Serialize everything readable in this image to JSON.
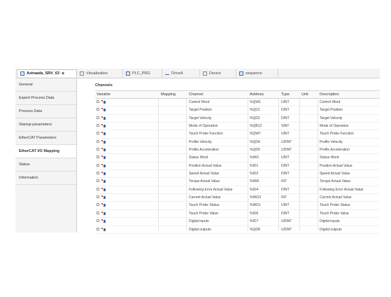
{
  "tabs": [
    {
      "label": "Astraada_SRV_63",
      "active": true,
      "icon": "device-icon",
      "close": "×"
    },
    {
      "label": "Visualization",
      "icon": "visualization-icon"
    },
    {
      "label": "PLC_PRG",
      "icon": "program-icon"
    },
    {
      "label": "DriveA",
      "icon": "trend-icon"
    },
    {
      "label": "Device",
      "icon": "device-icon"
    },
    {
      "label": "sequence",
      "icon": "sequence-icon"
    }
  ],
  "sidebar": {
    "items": [
      {
        "label": "General"
      },
      {
        "label": "Expert Process Data"
      },
      {
        "label": "Process Data"
      },
      {
        "label": "Startup parameters"
      },
      {
        "label": "EtherCAT Parameters"
      },
      {
        "label": "EtherCAT I/O Mapping",
        "active": true
      },
      {
        "label": "Status"
      },
      {
        "label": "Information"
      }
    ]
  },
  "main": {
    "section_title": "Channels",
    "columns": [
      "Variable",
      "Mapping",
      "Channel",
      "Address",
      "Type",
      "Unit",
      "Description"
    ],
    "rows": [
      {
        "channel": "Control Word",
        "address": "%QW1",
        "type": "UINT",
        "description": "Control Word"
      },
      {
        "channel": "Target Position",
        "address": "%QD1",
        "type": "DINT",
        "description": "Target Position"
      },
      {
        "channel": "Target Velocity",
        "address": "%QD2",
        "type": "DINT",
        "description": "Target Velocity"
      },
      {
        "channel": "Mode of Operation",
        "address": "%QB12",
        "type": "SINT",
        "description": "Mode of Operation"
      },
      {
        "channel": "Touch Probe Function",
        "address": "%QW7",
        "type": "UINT",
        "description": "Touch Probe Function"
      },
      {
        "channel": "Profile Velocity",
        "address": "%QD4",
        "type": "UDINT",
        "description": "Profile Velocity"
      },
      {
        "channel": "Profile Acceleration",
        "address": "%QD5",
        "type": "UDINT",
        "description": "Profile Acceleration"
      },
      {
        "channel": "Status Word",
        "address": "%IW1",
        "type": "UINT",
        "description": "Status Word"
      },
      {
        "channel": "Position Actual Value",
        "address": "%ID1",
        "type": "DINT",
        "description": "Position Actual Value"
      },
      {
        "channel": "Speed Actual Value",
        "address": "%ID2",
        "type": "DINT",
        "description": "Speed Actual Value"
      },
      {
        "channel": "Torque Actual Value",
        "address": "%IW6",
        "type": "INT",
        "description": "Torque Actual Value"
      },
      {
        "channel": "Following Error Actual Value",
        "address": "%ID4",
        "type": "DINT",
        "description": "Following Error Actual Value"
      },
      {
        "channel": "Current Actual Value",
        "address": "%IW10",
        "type": "INT",
        "description": "Current Actual Value"
      },
      {
        "channel": "Touch Probe Status",
        "address": "%IW11",
        "type": "UINT",
        "description": "Touch Probe Status"
      },
      {
        "channel": "Touch Probe Value",
        "address": "%ID6",
        "type": "DINT",
        "description": "Touch Probe Value"
      },
      {
        "channel": "Digital inputs",
        "address": "%ID7",
        "type": "UDINT",
        "description": "Digital inputs"
      },
      {
        "channel": "Digital outputs",
        "address": "%QD8",
        "type": "UDINT",
        "description": "Digital outputs"
      }
    ]
  }
}
